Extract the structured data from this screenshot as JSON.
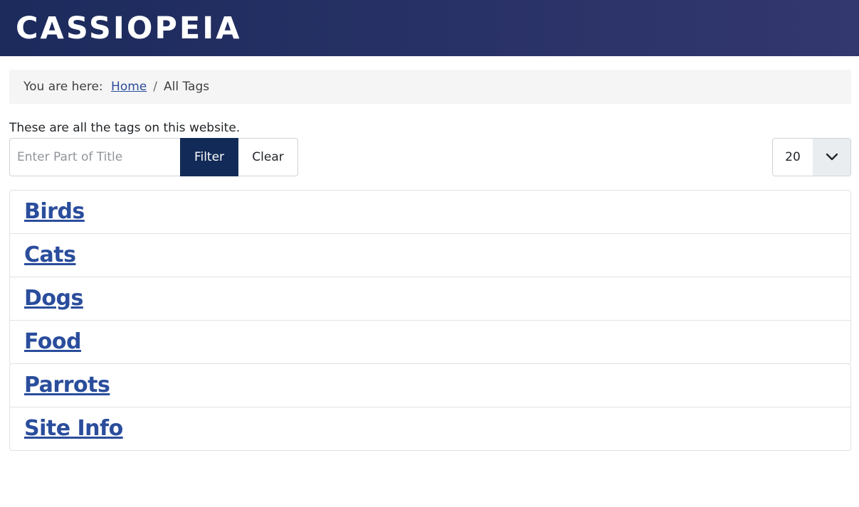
{
  "header": {
    "brand": "CASSIOPEIA"
  },
  "breadcrumb": {
    "prefix": "You are here:",
    "home": "Home",
    "separator": "/",
    "current": "All Tags"
  },
  "intro": "These are all the tags on this website.",
  "filter": {
    "placeholder": "Enter Part of Title",
    "value": "",
    "filter_label": "Filter",
    "clear_label": "Clear"
  },
  "limit": {
    "selected": "20",
    "icon": "chevron-down-icon"
  },
  "tags": {
    "group1": [
      "Birds",
      "Cats",
      "Dogs",
      "Food"
    ],
    "group2": [
      "Parrots",
      "Site Info"
    ]
  },
  "colors": {
    "header_start": "#1c2a5c",
    "header_end": "#33386e",
    "link": "#2a4d9c",
    "filter_button": "#122a57"
  }
}
